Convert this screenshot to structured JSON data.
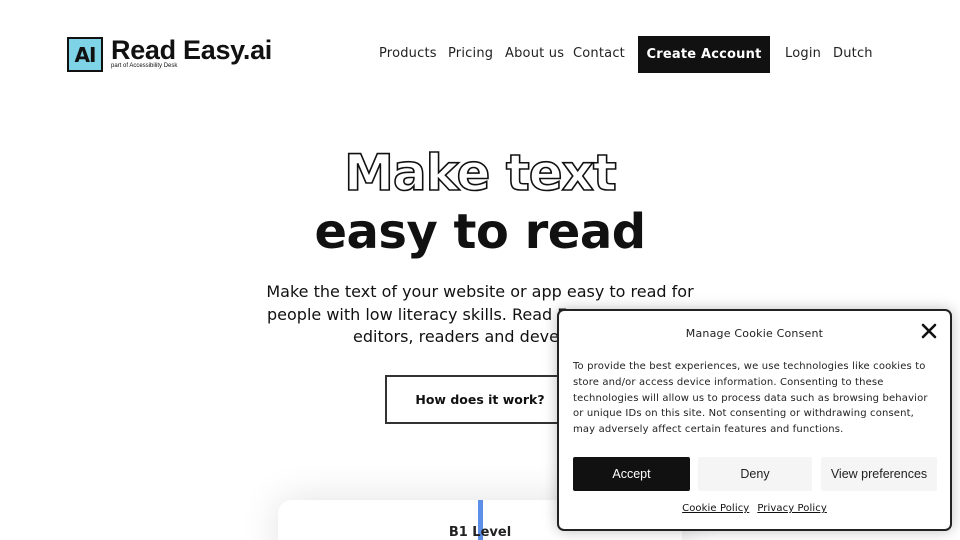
{
  "brand": {
    "mark": "AI",
    "name": "Read Easy.ai",
    "tagline": "part of Accessibility Desk"
  },
  "nav": {
    "items": [
      "Products",
      "Pricing",
      "About us",
      "Contact"
    ],
    "cta": "Create Account",
    "login": "Login",
    "language": "Dutch"
  },
  "hero": {
    "title_line1": "Make text",
    "title_line2": "easy to read",
    "subtitle": "Make the text of your website or app easy to read for people with low literacy skills. Read E… editors, readers and devel…",
    "subtitle_lines": [
      "Make the text of your website or app easy to read for",
      "people with low literacy skills. Read E",
      "editors, readers and devel"
    ],
    "button": "How does it work?"
  },
  "preview": {
    "label": "B1 Level"
  },
  "cookie": {
    "title": "Manage Cookie Consent",
    "body": "To provide the best experiences, we use technologies like cookies to store and/or access device information. Consenting to these technologies will allow us to process data such as browsing behavior or unique IDs on this site. Not consenting or withdrawing consent, may adversely affect certain features and functions.",
    "accept": "Accept",
    "deny": "Deny",
    "preferences": "View preferences",
    "links": [
      "Cookie Policy",
      "Privacy Policy"
    ]
  },
  "colors": {
    "logo_accent": "#7fd3e6",
    "primary_dark": "#111111",
    "cursor_blue": "#5b8fe8",
    "button_light": "#f5f5f5"
  }
}
